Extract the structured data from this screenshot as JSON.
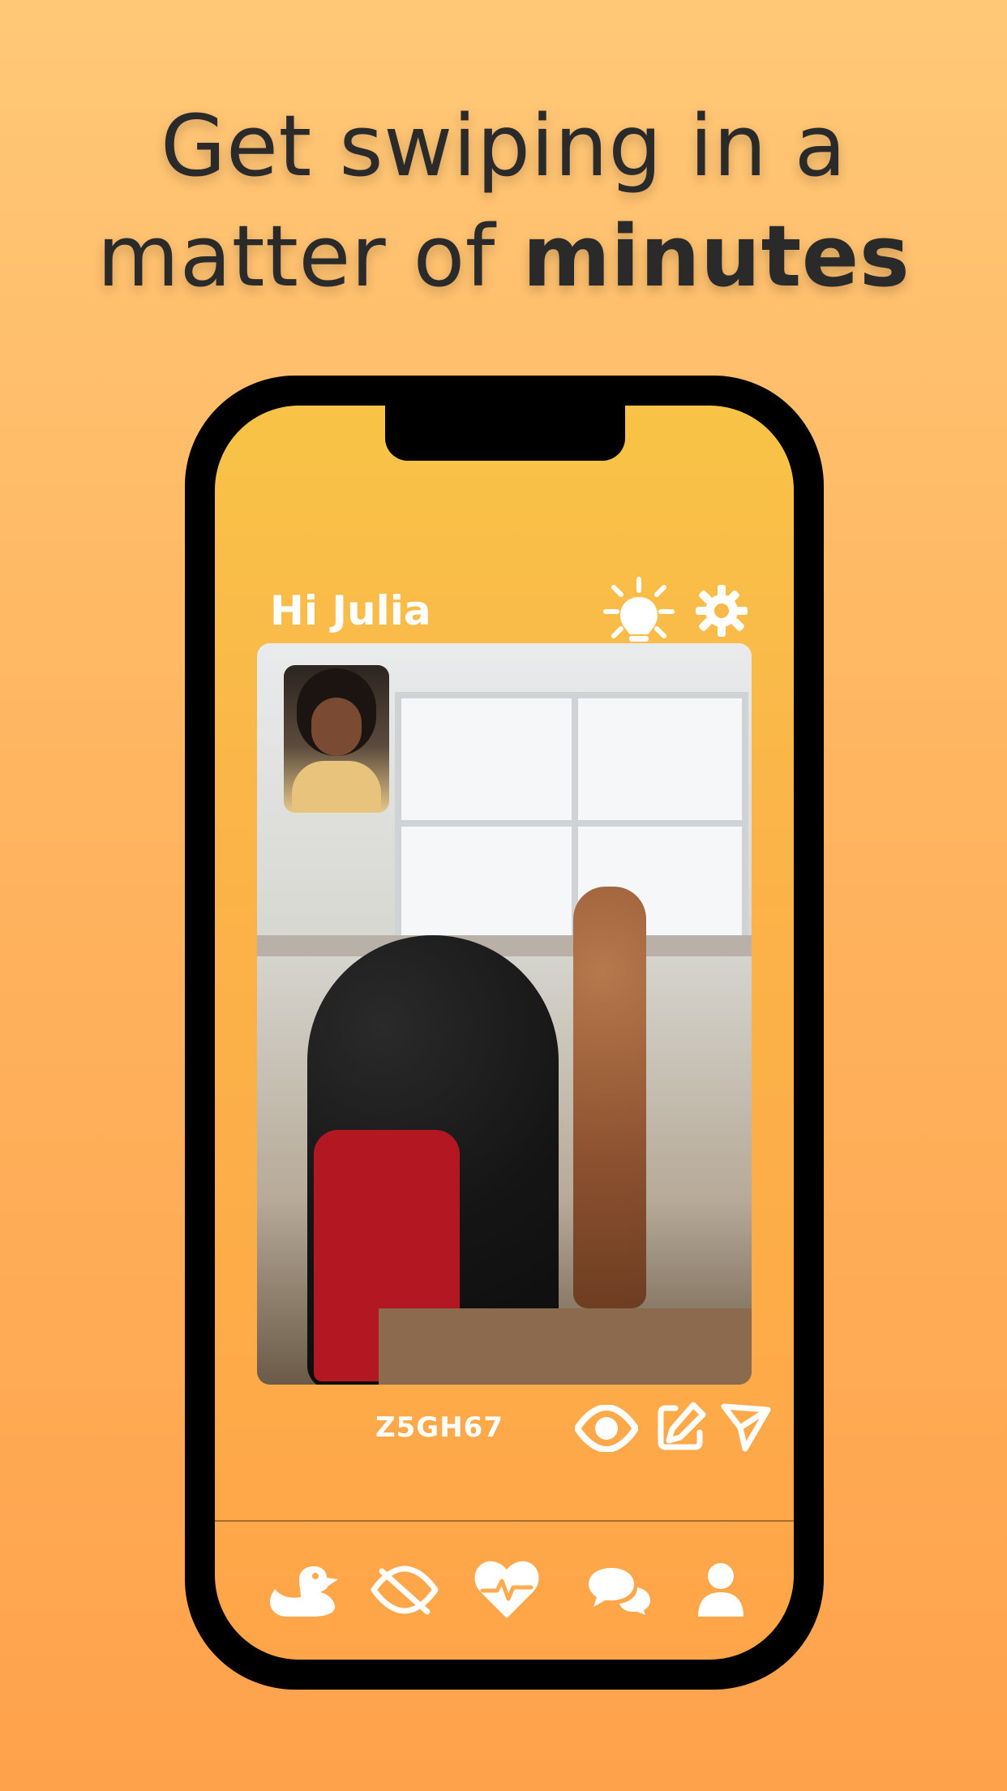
{
  "headline": {
    "line1": "Get swiping in a",
    "line2_regular": "matter of",
    "line2_bold": "minutes"
  },
  "phone": {
    "greeting": "Hi Julia",
    "top_icons": [
      {
        "name": "tips-lightbulb-icon"
      },
      {
        "name": "settings-gear-icon"
      }
    ],
    "photo": {
      "main_alt": "sculptor working on statue",
      "thumb_alt": "smiling woman profile picture"
    },
    "code": "Z5GH67",
    "photo_actions": [
      {
        "name": "eye-icon"
      },
      {
        "name": "edit-icon"
      },
      {
        "name": "send-icon"
      }
    ],
    "tabs": [
      {
        "name": "duck-icon"
      },
      {
        "name": "hidden-eye-icon"
      },
      {
        "name": "heart-pulse-icon"
      },
      {
        "name": "chat-bubbles-icon"
      },
      {
        "name": "profile-user-icon"
      }
    ]
  },
  "colors": {
    "bg_top": "#ffc877",
    "bg_bottom": "#ffa24c",
    "phone_frame": "#000000",
    "screen_top": "#f8c347",
    "screen_bottom": "#ffa549",
    "text_dark": "#2a2a2a",
    "text_light": "#ffffff"
  }
}
